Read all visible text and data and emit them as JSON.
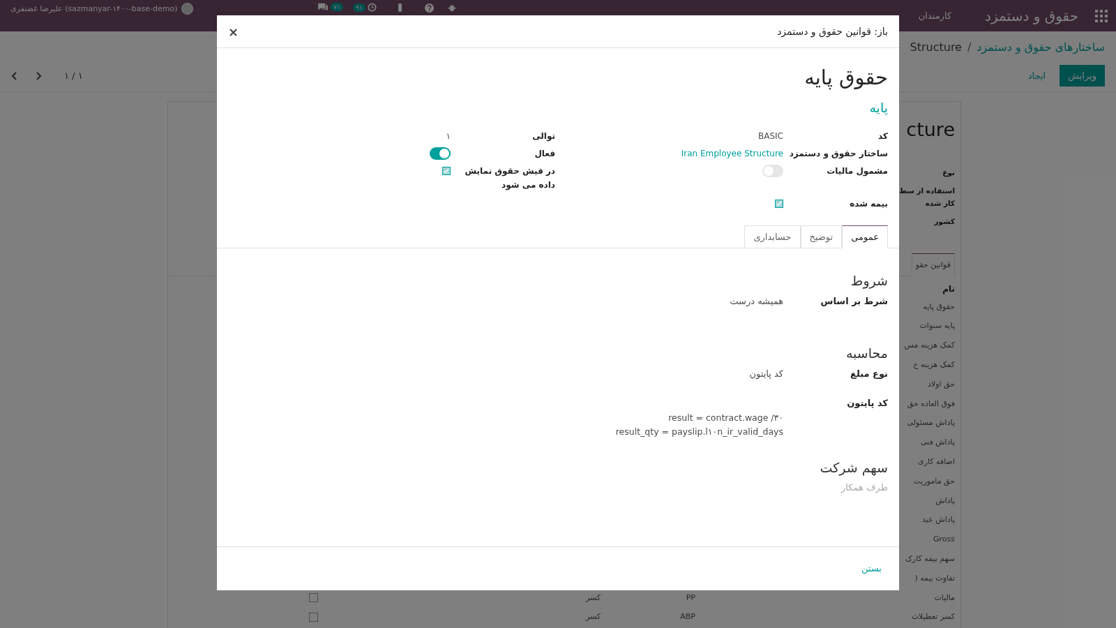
{
  "navbar": {
    "app_title": "حقوق و دستمزد",
    "menu": [
      "کارمندان"
    ],
    "user": "علیرضا غضنفری (sazmanyar-۱۴۰۰-base-demo)",
    "chat_badge": "۷۱",
    "activity_badge": "۹۱"
  },
  "control_panel": {
    "breadcrumb": [
      "ساختارهای حقوق و دستمزد",
      "Structure"
    ],
    "breadcrumb_separator": "/",
    "buttons": [
      "ویرایش",
      "ایجاد"
    ],
    "pager": "۱ / ۱"
  },
  "background_form": {
    "title": "cture",
    "labels": [
      "نوع",
      "استفاده از سط",
      "کار شده",
      "کشور"
    ],
    "tab": "قوانین حقو",
    "column": "نام",
    "rows": [
      {
        "name": "حقوق پایه"
      },
      {
        "name": "پایه سنوات"
      },
      {
        "name": "کمک هزینه مس"
      },
      {
        "name": "کمک هزینه خ"
      },
      {
        "name": "حق اولاد"
      },
      {
        "name": "فوق العاده حق"
      },
      {
        "name": "پاداش مسئولی"
      },
      {
        "name": "پاداش فنی"
      },
      {
        "name": "اضافه کاری"
      },
      {
        "name": "حق ماموریت"
      },
      {
        "name": "پاداش"
      },
      {
        "name": "پاداش عید"
      },
      {
        "name": "Gross"
      },
      {
        "name": "سهم بیمه کارک"
      },
      {
        "name": "تفاوت بیمه ("
      },
      {
        "name": "مالیات",
        "code": "PP",
        "category": "کسر",
        "checked": false
      },
      {
        "name": "کسر تعطیلات",
        "code": "ABP",
        "category": "کسر",
        "checked": false
      }
    ]
  },
  "dialog": {
    "title": "باز: قوانین حقوق و دستمزد",
    "close": "×",
    "name": "حقوق پایه",
    "category": "پایه",
    "field_groups": [
      [
        {
          "label": "کد",
          "kind": "text",
          "value": "BASIC"
        },
        {
          "label": "ساختار حقوق و دستمزد",
          "kind": "link",
          "value": "Iran Employee Structure"
        },
        {
          "label": "مشمول مالیات",
          "kind": "toggle",
          "on": false
        },
        {
          "label": "بیمه شده",
          "kind": "checkbox",
          "checked": true
        }
      ],
      [
        {
          "label": "توالی",
          "kind": "text",
          "value": "۱"
        },
        {
          "label": "فعال",
          "kind": "toggle",
          "on": true
        },
        {
          "label": "در فیش حقوق نمایش داده می شود",
          "kind": "checkbox",
          "checked": true
        }
      ]
    ],
    "tabs": [
      {
        "label": "عمومی",
        "selected": true
      },
      {
        "label": "توضیح",
        "selected": false
      },
      {
        "label": "حسابداری",
        "selected": false
      }
    ],
    "sections": [
      {
        "title": "شروط",
        "fields": [
          {
            "label": "شرط بر اساس",
            "kind": "text",
            "value": "همیشه درست"
          }
        ]
      },
      {
        "title": "محاسبه",
        "fields": [
          {
            "label": "نوع مبلغ",
            "kind": "text",
            "value": "کد پایتون"
          },
          {
            "label": "کد پایتون",
            "kind": "code",
            "lines": [
              "result = contract.wage /۳۰",
              "result_qty = payslip.l۱۰n_ir_valid_days"
            ]
          }
        ]
      },
      {
        "title": "سهم شرکت",
        "fields": [
          {
            "label": "طرف همکار",
            "kind": "empty"
          }
        ]
      }
    ],
    "footer_button": "بستن"
  }
}
